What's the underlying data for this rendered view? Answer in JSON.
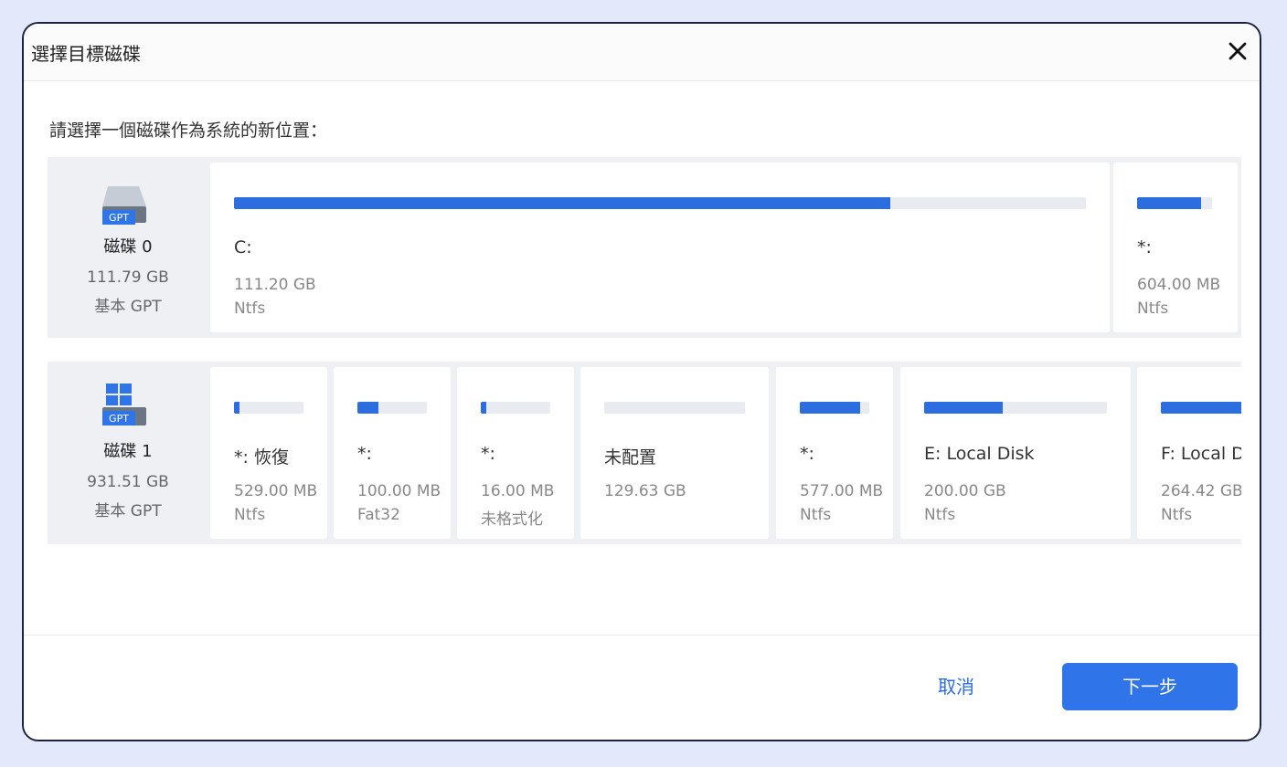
{
  "dialog": {
    "title": "選擇目標磁碟",
    "prompt": "請選擇一個磁碟作為系統的新位置："
  },
  "disks": [
    {
      "name": "磁碟 0",
      "size": "111.79 GB",
      "type": "基本 GPT",
      "badge": "GPT",
      "icon": "gpt-disk-icon",
      "partitions": [
        {
          "label": "C:",
          "size": "111.20 GB",
          "fs": "Ntfs",
          "used_fraction": 0.77
        },
        {
          "label": "*:",
          "size": "604.00 MB",
          "fs": "Ntfs",
          "used_fraction": 0.85
        }
      ]
    },
    {
      "name": "磁碟 1",
      "size": "931.51 GB",
      "type": "基本 GPT",
      "badge": "GPT",
      "icon": "windows-gpt-disk-icon",
      "partitions": [
        {
          "label": "*: 恢復",
          "size": "529.00 MB",
          "fs": "Ntfs",
          "used_fraction": 0.08
        },
        {
          "label": "*:",
          "size": "100.00 MB",
          "fs": "Fat32",
          "used_fraction": 0.3
        },
        {
          "label": "*:",
          "size": "16.00 MB",
          "fs": "未格式化",
          "used_fraction": 0.08
        },
        {
          "label": "未配置",
          "size": "129.63 GB",
          "fs": "",
          "used_fraction": 0.0
        },
        {
          "label": "*:",
          "size": "577.00 MB",
          "fs": "Ntfs",
          "used_fraction": 0.87
        },
        {
          "label": "E: Local Disk",
          "size": "200.00 GB",
          "fs": "Ntfs",
          "used_fraction": 0.43
        },
        {
          "label": "F: Local Disk",
          "size": "264.42 GB",
          "fs": "Ntfs",
          "used_fraction": 0.8
        }
      ]
    }
  ],
  "footer": {
    "cancel_label": "取消",
    "next_label": "下一步"
  },
  "colors": {
    "accent": "#2c6de0",
    "bar_track": "#e8ebf1",
    "row_bg": "#eef0f4"
  }
}
